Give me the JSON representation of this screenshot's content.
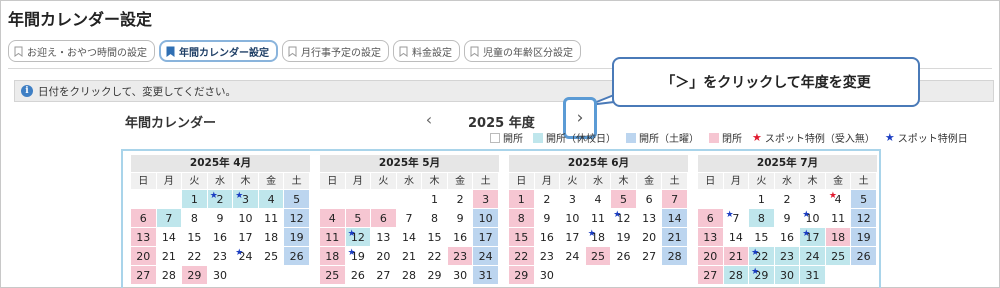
{
  "page_title": "年間カレンダー設定",
  "tabs": [
    {
      "label": "お迎え・おやつ時間の設定",
      "active": false
    },
    {
      "label": "年間カレンダー設定",
      "active": true
    },
    {
      "label": "月行事予定の設定",
      "active": false
    },
    {
      "label": "料金設定",
      "active": false
    },
    {
      "label": "児童の年齢区分設定",
      "active": false
    }
  ],
  "notice": "日付をクリックして、変更してください。",
  "calendar_heading": "年間カレンダー",
  "year_label": "2025 年度",
  "prev_glyph": "‹",
  "next_glyph": "›",
  "callout": "「＞」をクリックして年度を変更",
  "legend": {
    "open": "開所",
    "open_school_holiday": "開所（休校日）",
    "open_saturday": "開所（土曜）",
    "closed": "閉所",
    "spot_red": "スポット特例（受入無）",
    "spot_blue": "スポット特例日",
    "star": "★"
  },
  "colors": {
    "closed": "#f6c6d2",
    "school_holiday": "#bfe6ec",
    "saturday": "#bcd5ef",
    "frame": "#a9d4ea",
    "accent": "#5b9bd5"
  },
  "weekdays": [
    "日",
    "月",
    "火",
    "水",
    "木",
    "金",
    "土"
  ],
  "months": [
    {
      "title": "2025年 4月",
      "days": [
        {
          "d": ""
        },
        {
          "d": ""
        },
        {
          "d": "1",
          "t": "r"
        },
        {
          "d": "2",
          "t": "r",
          "star": "blue"
        },
        {
          "d": "3",
          "t": "r",
          "star": "blue"
        },
        {
          "d": "4",
          "t": "r"
        },
        {
          "d": "5",
          "t": "s"
        },
        {
          "d": "6",
          "t": "h"
        },
        {
          "d": "7",
          "t": "r"
        },
        {
          "d": "8"
        },
        {
          "d": "9"
        },
        {
          "d": "10"
        },
        {
          "d": "11"
        },
        {
          "d": "12",
          "t": "s"
        },
        {
          "d": "13",
          "t": "h"
        },
        {
          "d": "14"
        },
        {
          "d": "15"
        },
        {
          "d": "16"
        },
        {
          "d": "17"
        },
        {
          "d": "18"
        },
        {
          "d": "19",
          "t": "s"
        },
        {
          "d": "20",
          "t": "h"
        },
        {
          "d": "21"
        },
        {
          "d": "22"
        },
        {
          "d": "23"
        },
        {
          "d": "24",
          "star": "blue"
        },
        {
          "d": "25"
        },
        {
          "d": "26",
          "t": "s"
        },
        {
          "d": "27",
          "t": "h"
        },
        {
          "d": "28"
        },
        {
          "d": "29",
          "t": "h"
        },
        {
          "d": "30"
        },
        {
          "d": ""
        },
        {
          "d": ""
        },
        {
          "d": ""
        }
      ]
    },
    {
      "title": "2025年 5月",
      "days": [
        {
          "d": ""
        },
        {
          "d": ""
        },
        {
          "d": ""
        },
        {
          "d": ""
        },
        {
          "d": "1"
        },
        {
          "d": "2"
        },
        {
          "d": "3",
          "t": "h"
        },
        {
          "d": "4",
          "t": "h"
        },
        {
          "d": "5",
          "t": "h"
        },
        {
          "d": "6",
          "t": "h"
        },
        {
          "d": "7"
        },
        {
          "d": "8"
        },
        {
          "d": "9"
        },
        {
          "d": "10",
          "t": "s"
        },
        {
          "d": "11",
          "t": "h"
        },
        {
          "d": "12",
          "t": "r",
          "star": "blue"
        },
        {
          "d": "13"
        },
        {
          "d": "14"
        },
        {
          "d": "15"
        },
        {
          "d": "16"
        },
        {
          "d": "17",
          "t": "s"
        },
        {
          "d": "18",
          "t": "h"
        },
        {
          "d": "19",
          "star": "blue"
        },
        {
          "d": "20"
        },
        {
          "d": "21"
        },
        {
          "d": "22"
        },
        {
          "d": "23",
          "t": "h"
        },
        {
          "d": "24",
          "t": "s"
        },
        {
          "d": "25",
          "t": "h"
        },
        {
          "d": "26"
        },
        {
          "d": "27"
        },
        {
          "d": "28"
        },
        {
          "d": "29"
        },
        {
          "d": "30"
        },
        {
          "d": "31",
          "t": "s"
        }
      ]
    },
    {
      "title": "2025年 6月",
      "days": [
        {
          "d": "1",
          "t": "h"
        },
        {
          "d": "2"
        },
        {
          "d": "3"
        },
        {
          "d": "4"
        },
        {
          "d": "5",
          "t": "h"
        },
        {
          "d": "6"
        },
        {
          "d": "7",
          "t": "h"
        },
        {
          "d": "8",
          "t": "h"
        },
        {
          "d": "9"
        },
        {
          "d": "10"
        },
        {
          "d": "11"
        },
        {
          "d": "12",
          "star": "blue"
        },
        {
          "d": "13"
        },
        {
          "d": "14",
          "t": "s"
        },
        {
          "d": "15",
          "t": "h"
        },
        {
          "d": "16"
        },
        {
          "d": "17"
        },
        {
          "d": "18",
          "star": "blue"
        },
        {
          "d": "19"
        },
        {
          "d": "20"
        },
        {
          "d": "21",
          "t": "s"
        },
        {
          "d": "22",
          "t": "h"
        },
        {
          "d": "23"
        },
        {
          "d": "24"
        },
        {
          "d": "25",
          "t": "h"
        },
        {
          "d": "26"
        },
        {
          "d": "27"
        },
        {
          "d": "28",
          "t": "s"
        },
        {
          "d": "29",
          "t": "h"
        },
        {
          "d": "30"
        },
        {
          "d": ""
        },
        {
          "d": ""
        },
        {
          "d": ""
        },
        {
          "d": ""
        },
        {
          "d": ""
        }
      ]
    },
    {
      "title": "2025年 7月",
      "days": [
        {
          "d": ""
        },
        {
          "d": ""
        },
        {
          "d": "1"
        },
        {
          "d": "2"
        },
        {
          "d": "3"
        },
        {
          "d": "4",
          "star": "red"
        },
        {
          "d": "5",
          "t": "s"
        },
        {
          "d": "6",
          "t": "h"
        },
        {
          "d": "7",
          "star": "blue"
        },
        {
          "d": "8",
          "t": "r"
        },
        {
          "d": "9"
        },
        {
          "d": "10",
          "star": "blue"
        },
        {
          "d": "11"
        },
        {
          "d": "12",
          "t": "s"
        },
        {
          "d": "13",
          "t": "h"
        },
        {
          "d": "14"
        },
        {
          "d": "15"
        },
        {
          "d": "16"
        },
        {
          "d": "17",
          "t": "r",
          "star": "blue"
        },
        {
          "d": "18",
          "t": "h"
        },
        {
          "d": "19",
          "t": "s"
        },
        {
          "d": "20",
          "t": "h"
        },
        {
          "d": "21",
          "t": "h"
        },
        {
          "d": "22",
          "t": "r",
          "star": "blue"
        },
        {
          "d": "23",
          "t": "r"
        },
        {
          "d": "24",
          "t": "r"
        },
        {
          "d": "25",
          "t": "r"
        },
        {
          "d": "26",
          "t": "s"
        },
        {
          "d": "27",
          "t": "h"
        },
        {
          "d": "28",
          "t": "r"
        },
        {
          "d": "29",
          "t": "r",
          "star": "blue"
        },
        {
          "d": "30",
          "t": "r"
        },
        {
          "d": "31",
          "t": "r"
        },
        {
          "d": ""
        },
        {
          "d": ""
        }
      ]
    }
  ]
}
